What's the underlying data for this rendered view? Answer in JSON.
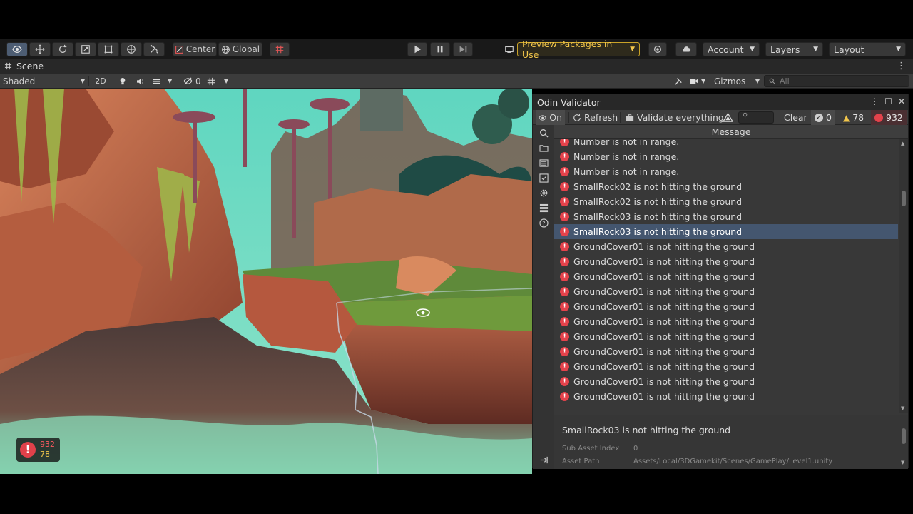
{
  "main_toolbar": {
    "tools": [
      "view-tool",
      "move-tool",
      "rotate-tool",
      "scale-tool",
      "rect-tool",
      "transform-tool",
      "custom-tool"
    ],
    "pivot_label": "Center",
    "space_label": "Global",
    "preview_packages_label": "Preview Packages in Use",
    "account_label": "Account",
    "layers_label": "Layers",
    "layout_label": "Layout"
  },
  "scene_tab": {
    "label": "Scene"
  },
  "scene_toolbar": {
    "shading_mode": "Shaded",
    "mode_2d": "2D",
    "hidden_count": "0",
    "gizmos_label": "Gizmos",
    "search_placeholder": "All"
  },
  "viewport_overlay": {
    "error_count": "932",
    "warning_count": "78"
  },
  "odin": {
    "title": "Odin Validator",
    "toolbar": {
      "on_label": "On",
      "refresh_label": "Refresh",
      "validate_label": "Validate everything",
      "clear_label": "Clear",
      "info_count": "0",
      "warning_count": "78",
      "error_count": "932"
    },
    "column_header": "Message",
    "messages": [
      {
        "text": "Number is not in range.",
        "selected": false
      },
      {
        "text": "Number is not in range.",
        "selected": false
      },
      {
        "text": "Number is not in range.",
        "selected": false
      },
      {
        "text": "SmallRock02 is not hitting the ground",
        "selected": false
      },
      {
        "text": "SmallRock02 is not hitting the ground",
        "selected": false
      },
      {
        "text": "SmallRock03 is not hitting the ground",
        "selected": false
      },
      {
        "text": "SmallRock03 is not hitting the ground",
        "selected": true
      },
      {
        "text": "GroundCover01 is not hitting the ground",
        "selected": false
      },
      {
        "text": "GroundCover01 is not hitting the ground",
        "selected": false
      },
      {
        "text": "GroundCover01 is not hitting the ground",
        "selected": false
      },
      {
        "text": "GroundCover01 is not hitting the ground",
        "selected": false
      },
      {
        "text": "GroundCover01 is not hitting the ground",
        "selected": false
      },
      {
        "text": "GroundCover01 is not hitting the ground",
        "selected": false
      },
      {
        "text": "GroundCover01 is not hitting the ground",
        "selected": false
      },
      {
        "text": "GroundCover01 is not hitting the ground",
        "selected": false
      },
      {
        "text": "GroundCover01 is not hitting the ground",
        "selected": false
      },
      {
        "text": "GroundCover01 is not hitting the ground",
        "selected": false
      },
      {
        "text": "GroundCover01 is not hitting the ground",
        "selected": false
      }
    ],
    "details": {
      "title": "SmallRock03 is not hitting the ground",
      "sub_asset_index_label": "Sub Asset Index",
      "sub_asset_index_value": "0",
      "asset_path_label": "Asset Path",
      "asset_path_value": "Assets/Local/3DGamekit/Scenes/GamePlay/Level1.unity"
    }
  },
  "colors": {
    "error": "#e3424b",
    "warning": "#f2c64b",
    "selection": "#44566f",
    "accent": "#c9a227"
  }
}
